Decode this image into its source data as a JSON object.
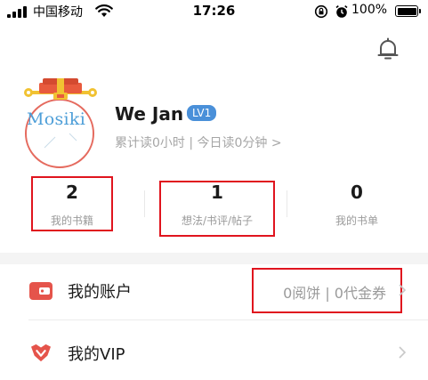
{
  "status_bar": {
    "carrier": "中国移动",
    "time": "17:26",
    "battery": "100%"
  },
  "profile": {
    "avatar_text": "Mosiki",
    "name": "We Jan",
    "level": "LV1",
    "read_stats": "累计读0小时 | 今日读0分钟 >"
  },
  "stats": [
    {
      "value": "2",
      "label": "我的书籍"
    },
    {
      "value": "1",
      "label": "想法/书评/帖子"
    },
    {
      "value": "0",
      "label": "我的书单"
    }
  ],
  "menu": {
    "account": {
      "label": "我的账户",
      "value": "0阅饼 | 0代金券"
    },
    "vip": {
      "label": "我的VIP"
    }
  },
  "colors": {
    "accent_blue": "#4a90d9",
    "account_icon": "#e5544b",
    "vip_icon": "#e5544b",
    "highlight_box": "#e0141e"
  },
  "icons": {
    "bell": "bell-icon",
    "account": "wallet-icon",
    "vip": "crown-icon",
    "chevron": "chevron-right-icon"
  }
}
